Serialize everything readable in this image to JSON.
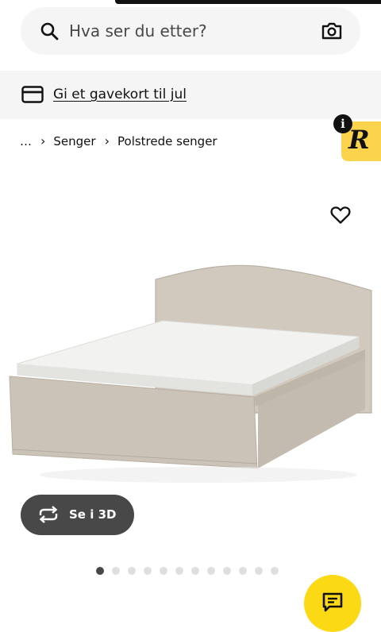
{
  "search": {
    "placeholder": "Hva ser du etter?"
  },
  "banner": {
    "link_text": "Gi et gavekort til jul"
  },
  "breadcrumb": {
    "ellipsis": "…",
    "items": [
      "Senger",
      "Polstrede senger"
    ]
  },
  "badge": {
    "letter": "R",
    "info": "i"
  },
  "product": {
    "view_3d_label": "Se i 3D",
    "image_count": 12,
    "active_image": 0
  },
  "colors": {
    "accent": "#fbd914",
    "badge": "#fcd34d",
    "button": "#484848"
  },
  "icons": [
    "search-icon",
    "camera-icon",
    "gift-card-icon",
    "heart-icon",
    "rotate-3d-icon",
    "chat-icon",
    "info-icon"
  ]
}
